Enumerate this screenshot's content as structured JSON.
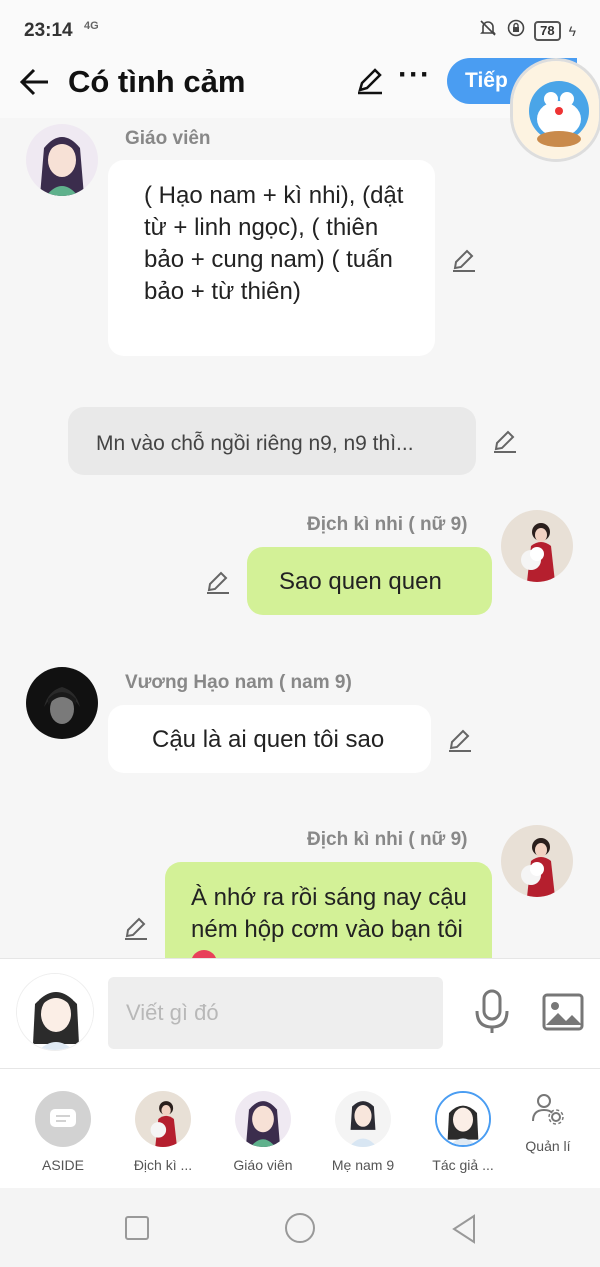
{
  "status": {
    "time": "23:14",
    "signal": "4G",
    "battery": "78"
  },
  "header": {
    "title": "Có tình cảm",
    "next_label": "Tiếp"
  },
  "messages": [
    {
      "sender": "Giáo viên",
      "text": "( Hạo nam + kì nhi), (dật từ + linh ngọc), ( thiên bảo + cung nam) ( tuấn bảo + từ thiên)"
    },
    {
      "sender": "",
      "text": "Mn vào chỗ ngồi riêng n9, n9 thì..."
    },
    {
      "sender": "Địch kì nhi ( nữ 9)",
      "text": "Sao quen quen"
    },
    {
      "sender": "Vương Hạo nam ( nam 9)",
      "text": "Cậu là ai quen tôi sao"
    },
    {
      "sender": "Địch kì nhi ( nữ 9)",
      "text": "À nhớ ra rồi sáng nay cậu ném hộp cơm vào bạn tôi"
    }
  ],
  "composer": {
    "placeholder": "Viết gì đó"
  },
  "characters": [
    {
      "label": "ASIDE"
    },
    {
      "label": "Địch kì ..."
    },
    {
      "label": "Giáo viên"
    },
    {
      "label": "Mẹ nam 9"
    },
    {
      "label": "Tác giả ..."
    }
  ],
  "manage_label": "Quản lí",
  "colors": {
    "accent": "#4a9df2",
    "bubble_green": "#d3f197",
    "background": "#f6f6f6"
  }
}
